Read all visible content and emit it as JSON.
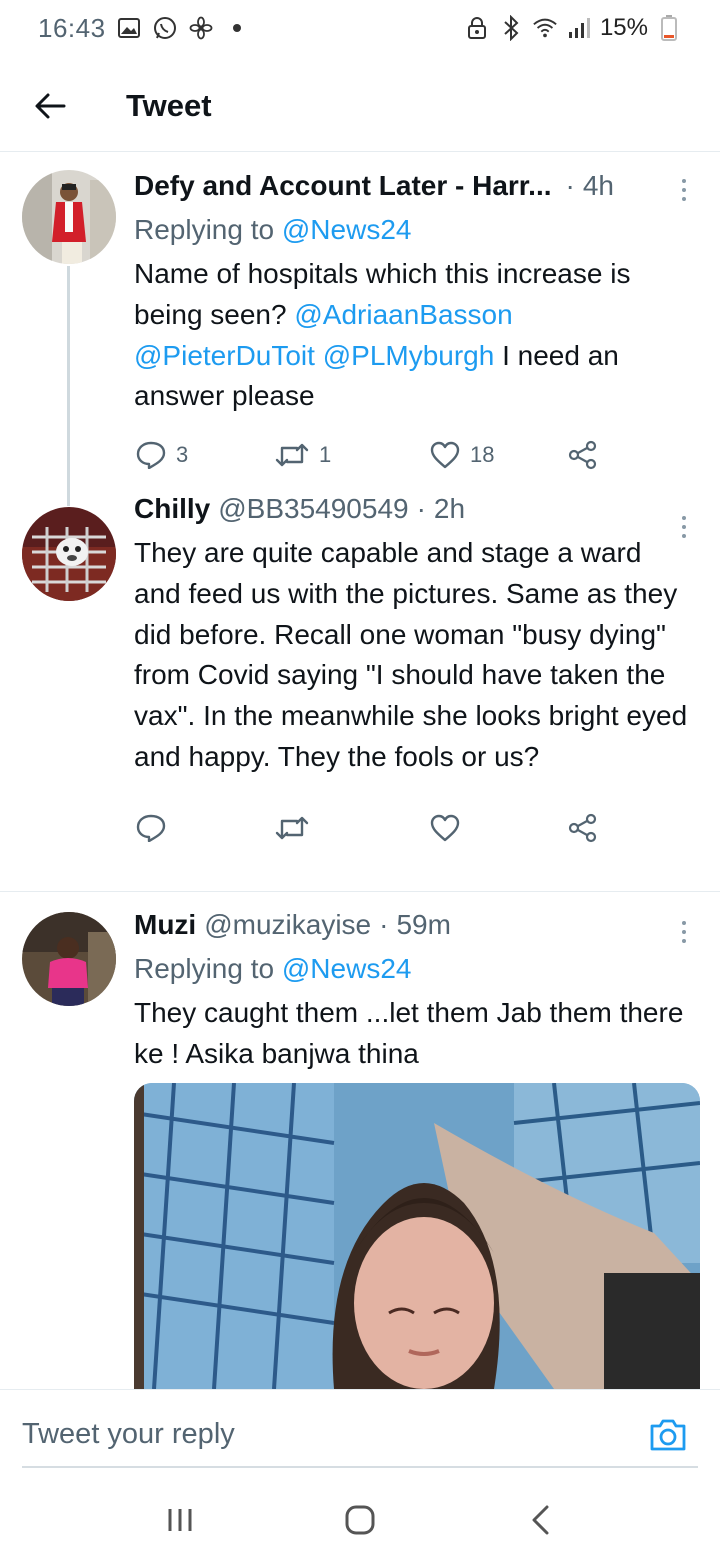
{
  "status_bar": {
    "time": "16:43",
    "battery": "15%",
    "left_icons": [
      "gallery-icon",
      "whatsapp-icon",
      "fan-icon",
      "dot-icon"
    ],
    "right_icons": [
      "lock-icon",
      "bluetooth-icon",
      "wifi-icon",
      "signal-icon",
      "battery-icon"
    ]
  },
  "header": {
    "title": "Tweet"
  },
  "tweets": [
    {
      "name": "Defy and Account Later - Harr...",
      "handle": "",
      "dot": "·",
      "time": "4h",
      "replying_prefix": "Replying to ",
      "replying_to": "@News24",
      "text_plain_1": "Name of hospitals which this increase is being seen? ",
      "mention_1": "@AdriaanBasson",
      "mention_2": "@PieterDuToit",
      "mention_3": "@PLMyburgh",
      "text_plain_2": " I need an answer please",
      "replies": "3",
      "retweets": "1",
      "likes": "18"
    },
    {
      "name": "Chilly",
      "handle": "@BB35490549",
      "dot": "·",
      "time": "2h",
      "text": "They are quite capable and stage a ward and feed us with the pictures. Same as they did before. Recall one woman \"busy dying\" from Covid saying \"I should have taken the vax\". In the meanwhile she looks bright eyed and happy. They the fools or us?",
      "replies": "",
      "retweets": "",
      "likes": ""
    },
    {
      "name": "Muzi",
      "handle": "@muzikayise",
      "dot": "·",
      "time": "59m",
      "replying_prefix": "Replying to ",
      "replying_to": "@News24",
      "text": "They caught them ...let them Jab them there ke ! Asika banjwa thina"
    }
  ],
  "reply_bar": {
    "placeholder": "Tweet your reply"
  },
  "colors": {
    "accent": "#1d9bf0",
    "text": "#0f1419",
    "secondary": "#536471",
    "divider": "#e6ecf0"
  }
}
